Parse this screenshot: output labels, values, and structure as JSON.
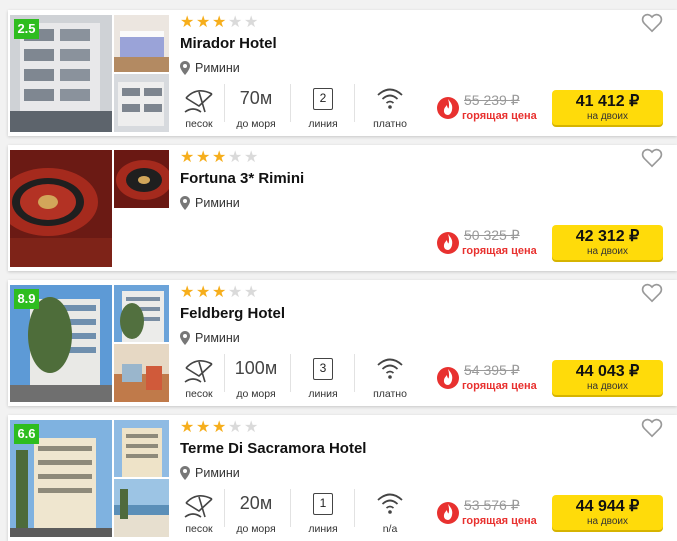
{
  "hotels": [
    {
      "rating": "2.5",
      "stars": 3,
      "name": "Mirador Hotel",
      "location": "Римини",
      "beach_label": "песок",
      "distance_value": "70м",
      "distance_label": "до моря",
      "line_value": "2",
      "line_label": "линия",
      "wifi_label": "платно",
      "old_price": "55 239 ₽",
      "hot_label": "горящая цена",
      "price": "41 412 ₽",
      "price_sub": "на двоих"
    },
    {
      "stars": 3,
      "name": "Fortuna 3* Rimini",
      "location": "Римини",
      "old_price": "50 325 ₽",
      "hot_label": "горящая цена",
      "price": "42 312 ₽",
      "price_sub": "на двоих"
    },
    {
      "rating": "8.9",
      "stars": 3,
      "name": "Feldberg Hotel",
      "location": "Римини",
      "beach_label": "песок",
      "distance_value": "100м",
      "distance_label": "до моря",
      "line_value": "3",
      "line_label": "линия",
      "wifi_label": "платно",
      "old_price": "54 395 ₽",
      "hot_label": "горящая цена",
      "price": "44 043 ₽",
      "price_sub": "на двоих"
    },
    {
      "rating": "6.6",
      "stars": 3,
      "name": "Terme Di Sacramora Hotel",
      "location": "Римини",
      "beach_label": "песок",
      "distance_value": "20м",
      "distance_label": "до моря",
      "line_value": "1",
      "line_label": "линия",
      "wifi_label": "n/a",
      "old_price": "53 576 ₽",
      "hot_label": "горящая цена",
      "price": "44 944 ₽",
      "price_sub": "на двоих"
    }
  ],
  "icons": {
    "favorite": "heart-outline-icon",
    "location": "map-pin-icon",
    "beach": "beach-umbrella-icon",
    "wifi": "wifi-icon",
    "hot": "fire-icon"
  },
  "colors": {
    "rating_badge": "#2ebd1f",
    "star_on": "#f6ae1c",
    "star_off": "#dadada",
    "hot_red": "#e8312f",
    "price_button": "#ffdb0a"
  }
}
